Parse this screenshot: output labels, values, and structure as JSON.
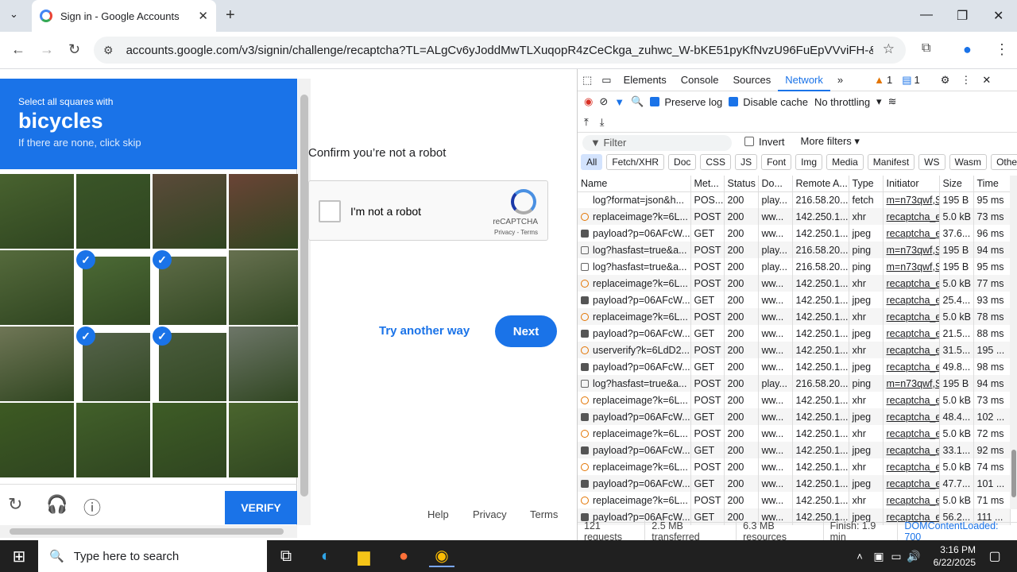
{
  "browser": {
    "tab_title": "Sign in - Google Accounts",
    "url": "accounts.google.com/v3/signin/challenge/recaptcha?TL=ALgCv6yJoddMwTLXuqopR4zCeCkga_zuhwc_W-bKE51pyKfNvzU96FuEpVVviFH-&checkConn..."
  },
  "captcha": {
    "instruction": "Select all squares with",
    "target": "bicycles",
    "hint": "If there are none, click skip",
    "verify_label": "VERIFY",
    "selected": [
      5,
      6,
      9,
      10
    ],
    "icons": [
      "reload-icon",
      "audio-icon",
      "info-icon"
    ]
  },
  "page": {
    "confirm": "Confirm you’re not a robot",
    "checkbox_label": "I'm not a robot",
    "recaptcha_brand": "reCAPTCHA",
    "privacy_terms": "Privacy - Terms",
    "try_another": "Try another way",
    "next": "Next",
    "footer": [
      "Help",
      "Privacy",
      "Terms"
    ]
  },
  "devtools": {
    "tabs": [
      "Elements",
      "Console",
      "Sources",
      "Network"
    ],
    "warnings": "1",
    "messages": "1",
    "preserve_log": "Preserve log",
    "disable_cache": "Disable cache",
    "throttling": "No throttling",
    "filter_placeholder": "Filter",
    "invert": "Invert",
    "more_filters": "More filters",
    "types": [
      "All",
      "Fetch/XHR",
      "Doc",
      "CSS",
      "JS",
      "Font",
      "Img",
      "Media",
      "Manifest",
      "WS",
      "Wasm",
      "Other"
    ],
    "columns": [
      "Name",
      "Met...",
      "Status",
      "Do...",
      "Remote A...",
      "Type",
      "Initiator",
      "Size",
      "Time"
    ],
    "rows": [
      [
        "log?format=json&h...",
        "POS...",
        "200",
        "play...",
        "216.58.20...",
        "fetch",
        "m=n73qwf,S",
        "195 B",
        "95 ms"
      ],
      [
        "replaceimage?k=6L...",
        "POST",
        "200",
        "ww...",
        "142.250.1...",
        "xhr",
        "recaptcha_e",
        "5.0 kB",
        "73 ms"
      ],
      [
        "payload?p=06AFcW...",
        "GET",
        "200",
        "ww...",
        "142.250.1...",
        "jpeg",
        "recaptcha_e",
        "37.6...",
        "96 ms"
      ],
      [
        "log?hasfast=true&a...",
        "POST",
        "200",
        "play...",
        "216.58.20...",
        "ping",
        "m=n73qwf,S",
        "195 B",
        "94 ms"
      ],
      [
        "log?hasfast=true&a...",
        "POST",
        "200",
        "play...",
        "216.58.20...",
        "ping",
        "m=n73qwf,S",
        "195 B",
        "95 ms"
      ],
      [
        "replaceimage?k=6L...",
        "POST",
        "200",
        "ww...",
        "142.250.1...",
        "xhr",
        "recaptcha_e",
        "5.0 kB",
        "77 ms"
      ],
      [
        "payload?p=06AFcW...",
        "GET",
        "200",
        "ww...",
        "142.250.1...",
        "jpeg",
        "recaptcha_e",
        "25.4...",
        "93 ms"
      ],
      [
        "replaceimage?k=6L...",
        "POST",
        "200",
        "ww...",
        "142.250.1...",
        "xhr",
        "recaptcha_e",
        "5.0 kB",
        "78 ms"
      ],
      [
        "payload?p=06AFcW...",
        "GET",
        "200",
        "ww...",
        "142.250.1...",
        "jpeg",
        "recaptcha_e",
        "21.5...",
        "88 ms"
      ],
      [
        "userverify?k=6LdD2...",
        "POST",
        "200",
        "ww...",
        "142.250.1...",
        "xhr",
        "recaptcha_e",
        "31.5...",
        "195 ..."
      ],
      [
        "payload?p=06AFcW...",
        "GET",
        "200",
        "ww...",
        "142.250.1...",
        "jpeg",
        "recaptcha_e",
        "49.8...",
        "98 ms"
      ],
      [
        "log?hasfast=true&a...",
        "POST",
        "200",
        "play...",
        "216.58.20...",
        "ping",
        "m=n73qwf,S",
        "195 B",
        "94 ms"
      ],
      [
        "replaceimage?k=6L...",
        "POST",
        "200",
        "ww...",
        "142.250.1...",
        "xhr",
        "recaptcha_e",
        "5.0 kB",
        "73 ms"
      ],
      [
        "payload?p=06AFcW...",
        "GET",
        "200",
        "ww...",
        "142.250.1...",
        "jpeg",
        "recaptcha_e",
        "48.4...",
        "102 ..."
      ],
      [
        "replaceimage?k=6L...",
        "POST",
        "200",
        "ww...",
        "142.250.1...",
        "xhr",
        "recaptcha_e",
        "5.0 kB",
        "72 ms"
      ],
      [
        "payload?p=06AFcW...",
        "GET",
        "200",
        "ww...",
        "142.250.1...",
        "jpeg",
        "recaptcha_e",
        "33.1...",
        "92 ms"
      ],
      [
        "replaceimage?k=6L...",
        "POST",
        "200",
        "ww...",
        "142.250.1...",
        "xhr",
        "recaptcha_e",
        "5.0 kB",
        "74 ms"
      ],
      [
        "payload?p=06AFcW...",
        "GET",
        "200",
        "ww...",
        "142.250.1...",
        "jpeg",
        "recaptcha_e",
        "47.7...",
        "101 ..."
      ],
      [
        "replaceimage?k=6L...",
        "POST",
        "200",
        "ww...",
        "142.250.1...",
        "xhr",
        "recaptcha_e",
        "5.0 kB",
        "71 ms"
      ],
      [
        "payload?p=06AFcW...",
        "GET",
        "200",
        "ww...",
        "142.250.1...",
        "jpeg",
        "recaptcha_e",
        "56.2...",
        "111 ..."
      ]
    ],
    "status": [
      "121 requests",
      "2.5 MB transferred",
      "6.3 MB resources",
      "Finish: 1.9 min",
      "DOMContentLoaded: 700"
    ]
  },
  "taskbar": {
    "search_placeholder": "Type here to search",
    "time": "3:16 PM",
    "date": "6/22/2025"
  }
}
